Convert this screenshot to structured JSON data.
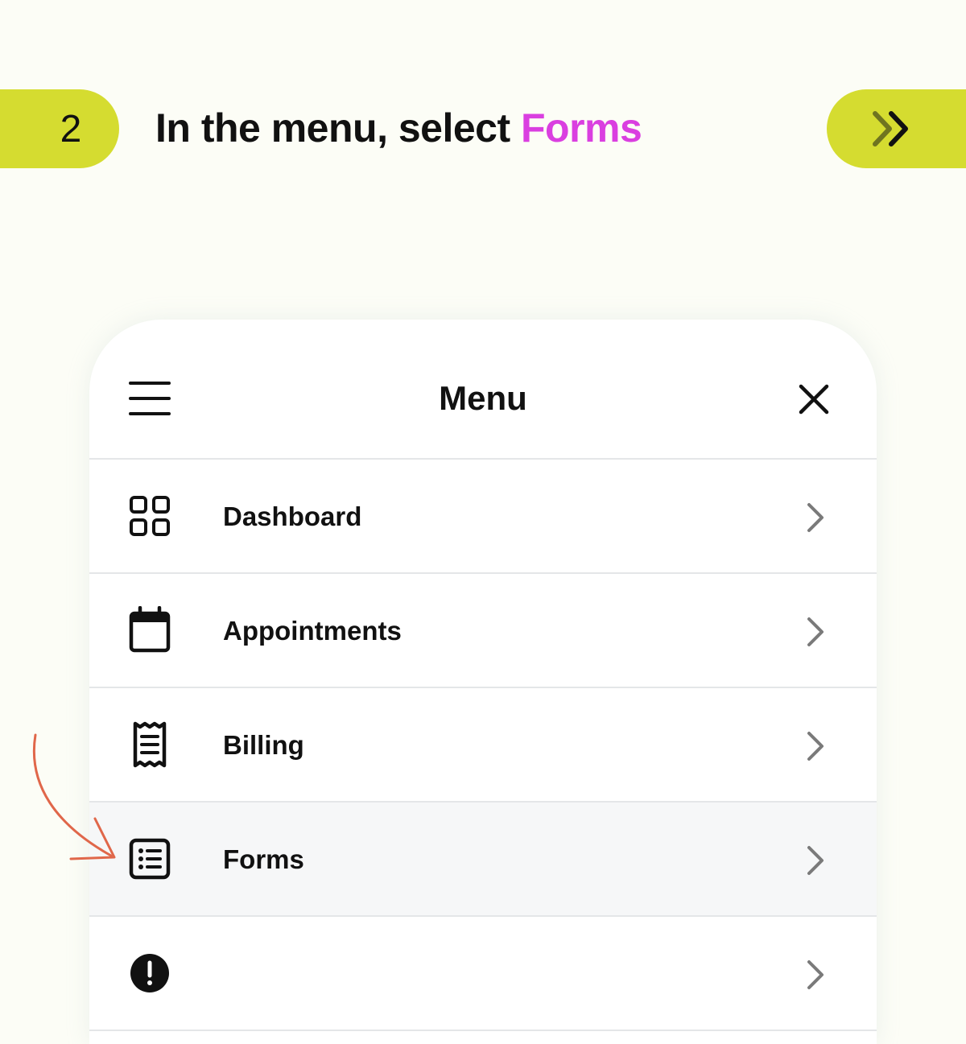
{
  "step": {
    "number": "2",
    "instruction_prefix": "In the menu, select ",
    "instruction_highlight": "Forms"
  },
  "colors": {
    "accent": "#d5dc30",
    "highlight": "#da3fe0",
    "arrow": "#e0674a",
    "background": "#fcfdf6"
  },
  "menu": {
    "title": "Menu",
    "items": [
      {
        "label": "Dashboard",
        "icon": "grid-icon",
        "active": false
      },
      {
        "label": "Appointments",
        "icon": "calendar-icon",
        "active": false
      },
      {
        "label": "Billing",
        "icon": "receipt-icon",
        "active": false
      },
      {
        "label": "Forms",
        "icon": "form-list-icon",
        "active": true
      }
    ]
  }
}
